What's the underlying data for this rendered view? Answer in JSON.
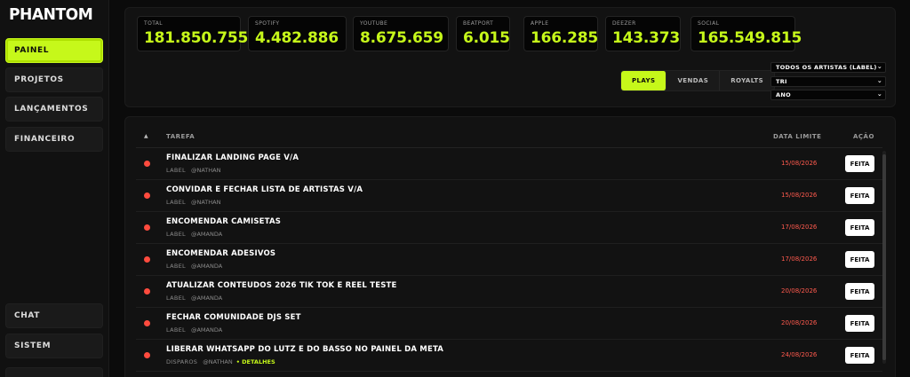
{
  "brand": {
    "logo": "PHANTOM"
  },
  "sidebar": {
    "items": [
      {
        "label": "PAINEL",
        "active": true
      },
      {
        "label": "PROJETOS"
      },
      {
        "label": "LANÇAMENTOS"
      },
      {
        "label": "FINANCEIRO"
      }
    ],
    "bottom_items": [
      {
        "label": "CHAT"
      },
      {
        "label": "SISTEM"
      },
      {
        "label": ""
      }
    ]
  },
  "stats": [
    {
      "label": "TOTAL",
      "value": "181.850.755"
    },
    {
      "label": "SPOTIFY",
      "value": "4.482.886"
    },
    {
      "label": "YOUTUBE",
      "value": "8.675.659"
    },
    {
      "label": "BEATPORT",
      "value": "6.015"
    },
    {
      "label": "APPLE",
      "value": "166.285"
    },
    {
      "label": "DEEZER",
      "value": "143.373"
    },
    {
      "label": "SOCIAL",
      "value": "165.549.815"
    }
  ],
  "metric_tabs": [
    {
      "label": "PLAYS",
      "active": true
    },
    {
      "label": "VENDAS"
    },
    {
      "label": "ROYALTS"
    }
  ],
  "filters": {
    "artists": "TODOS OS ARTISTAS (LABEL)",
    "period": "TRI",
    "year": "ANO"
  },
  "tasks_table": {
    "sort_icon": "▲",
    "headers": {
      "task": "TAREFA",
      "due_date": "DATA LIMITE",
      "action": "AÇÃO"
    },
    "action_label": "FEITA",
    "status_color": "#ff4b3e",
    "rows": [
      {
        "title": "FINALIZAR LANDING PAGE V/A",
        "channel": "LABEL",
        "owner": "@NATHAN",
        "due": "15/08/2026"
      },
      {
        "title": "CONVIDAR E FECHAR LISTA DE ARTISTAS V/A",
        "channel": "LABEL",
        "owner": "@NATHAN",
        "due": "15/08/2026"
      },
      {
        "title": "ENCOMENDAR CAMISETAS",
        "channel": "LABEL",
        "owner": "@AMANDA",
        "due": "17/08/2026"
      },
      {
        "title": "ENCOMENDAR ADESIVOS",
        "channel": "LABEL",
        "owner": "@AMANDA",
        "due": "17/08/2026"
      },
      {
        "title": "ATUALIZAR CONTEUDOS 2026 TIK TOK E REEL TESTE",
        "channel": "LABEL",
        "owner": "@AMANDA",
        "due": "20/08/2026"
      },
      {
        "title": "FECHAR COMUNIDADE DJS SET",
        "channel": "LABEL",
        "owner": "@AMANDA",
        "due": "20/08/2026"
      },
      {
        "title": "LIBERAR WHATSAPP DO LUTZ E DO BASSO NO PAINEL DA META",
        "channel": "DISPAROS",
        "owner": "@NATHAN",
        "due": "24/08/2026",
        "extra": "• DETALHES"
      }
    ]
  },
  "colors": {
    "accent": "#c6f81a",
    "danger": "#ff4b3e",
    "background": "#0b0b0b",
    "panel": "#121212"
  }
}
